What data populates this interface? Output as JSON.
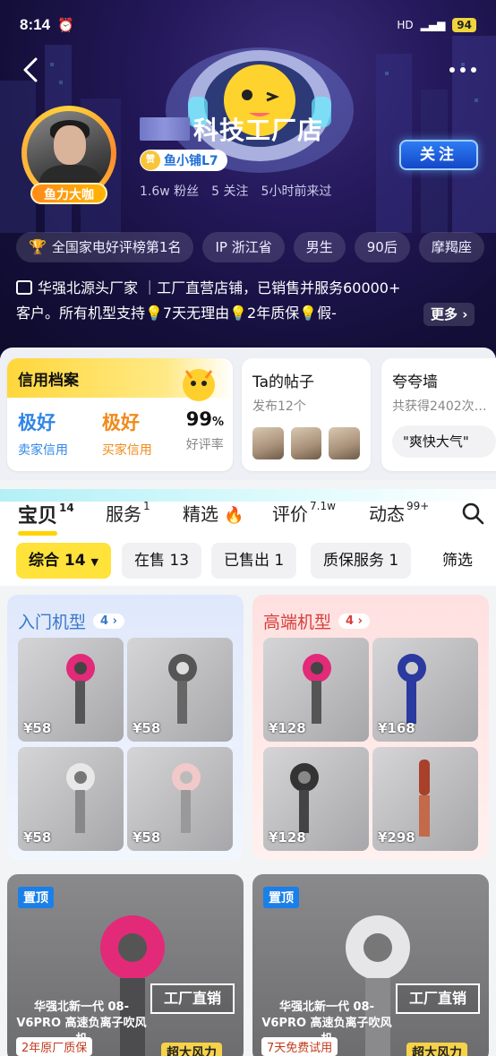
{
  "status_bar": {
    "time": "8:14",
    "signal": "HD",
    "battery": "94"
  },
  "shop": {
    "avatar_badge": "鱼力大咖",
    "name": "科技工厂店",
    "level": "鱼小铺L7",
    "follow_label": "关注",
    "stats": [
      "1.6w 粉丝",
      "5 关注",
      "5小时前来过"
    ]
  },
  "tags": [
    "全国家电好评榜第1名",
    "IP 浙江省",
    "男生",
    "90后",
    "摩羯座"
  ],
  "description": {
    "line1": "华强北源头厂家 ｜工厂直营店铺，已销售并服务60000+",
    "line2": "客户。所有机型支持💡7天无理由💡2年质保💡假-",
    "more_label": "更多"
  },
  "credit_card": {
    "title": "信用档案",
    "seller_value": "极好",
    "seller_label": "卖家信用",
    "buyer_value": "极好",
    "buyer_label": "买家信用",
    "rate_value": "99",
    "rate_unit": "%",
    "rate_label": "好评率"
  },
  "posts_card": {
    "title": "Ta的帖子",
    "subtitle": "发布12个"
  },
  "praise_card": {
    "title": "夸夸墙",
    "subtitle": "共获得2402次…",
    "quote": "\"爽快大气\""
  },
  "tabs": [
    {
      "label": "宝贝",
      "count": "14"
    },
    {
      "label": "服务",
      "count": "1"
    },
    {
      "label": "精选",
      "count": ""
    },
    {
      "label": "评价",
      "count": "7.1w"
    },
    {
      "label": "动态",
      "count": "99+"
    }
  ],
  "filters": [
    {
      "label": "综合 14"
    },
    {
      "label": "在售 13"
    },
    {
      "label": "已售出 1"
    },
    {
      "label": "质保服务 1"
    },
    {
      "label": "筛选"
    }
  ],
  "panels": {
    "left": {
      "title": "入门机型",
      "count": "4",
      "prices": [
        "¥58",
        "¥58",
        "¥58",
        "¥58"
      ]
    },
    "right": {
      "title": "高端机型",
      "count": "4",
      "prices": [
        "¥128",
        "¥168",
        "¥128",
        "¥298"
      ]
    }
  },
  "pinned": [
    {
      "pin": "置顶",
      "headline": "华强北新一代 08-V6PRO 高速负离子吹风机",
      "badge": "工厂直销",
      "feature": "2年原厂质保",
      "feature2": "超大风力"
    },
    {
      "pin": "置顶",
      "headline": "华强北新一代 08-V6PRO 高速负离子吹风机",
      "badge": "工厂直销",
      "feature": "7天免费试用",
      "feature2": "超大风力"
    }
  ],
  "colors": {
    "accent_yellow": "#ffe23a",
    "follow_blue": "#1f5fe0",
    "brand_blue": "#2f86e6",
    "buyer_orange": "#f08a1b"
  }
}
